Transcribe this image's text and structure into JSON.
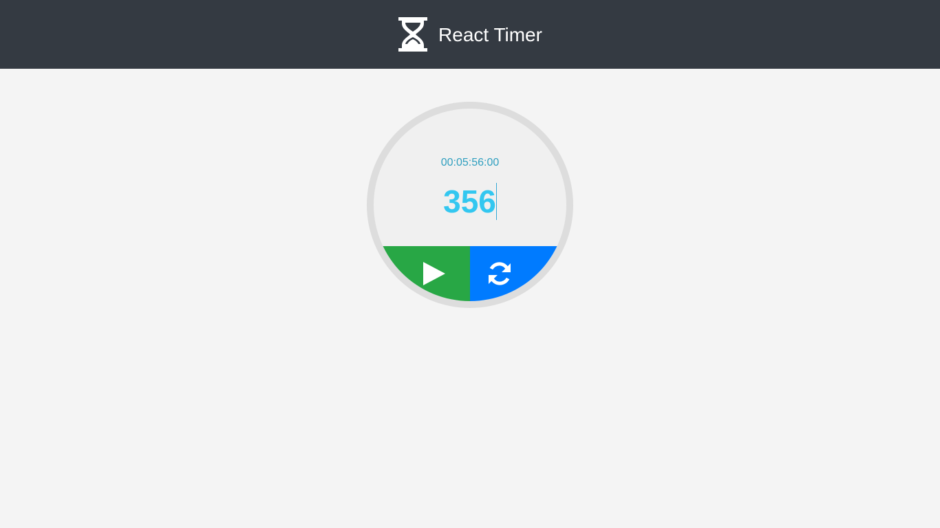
{
  "header": {
    "title": "React Timer",
    "icon": "hourglass-icon",
    "background": "#343a42"
  },
  "timer": {
    "time_display": "00:05:56:00",
    "seconds_value": "356",
    "start_button": {
      "icon": "play-icon",
      "color": "#28a745"
    },
    "reset_button": {
      "icon": "refresh-icon",
      "color": "#007bff"
    },
    "ring_color": "#dddddd",
    "face_color": "#f0f0f0",
    "value_color": "#33c7f0"
  }
}
